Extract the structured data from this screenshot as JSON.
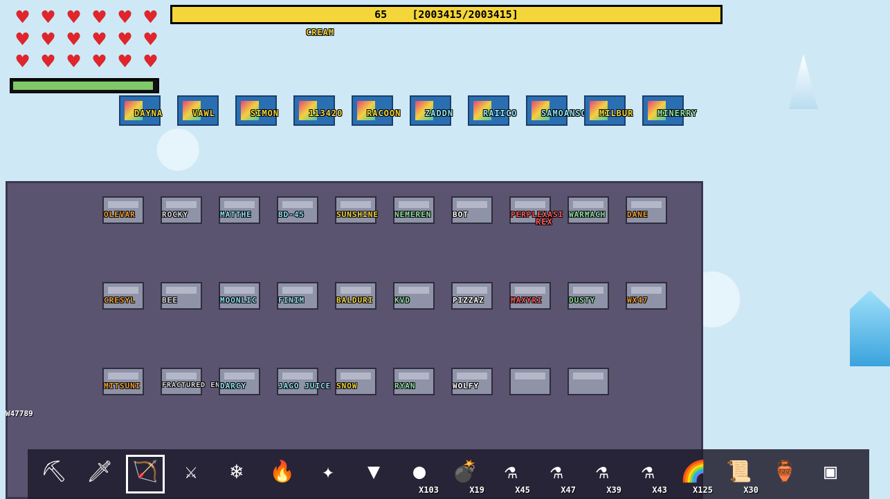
{
  "hud": {
    "hearts": 18,
    "heart_icon": "♥",
    "energy_fraction": 0.98,
    "level": "65",
    "xp_text": "[2003415/2003415]"
  },
  "top_row_names": [
    "CREAM"
  ],
  "pedestal_names": [
    "DAYNA",
    "VAWL",
    "SIMON",
    "113420",
    "RACOON",
    "ZADDN",
    "RAIICO",
    "SAMOANSO",
    "MILBUR",
    "MINERRY"
  ],
  "statue_rows": [
    [
      "OLEVAR",
      "ROCKY",
      "MATTHE",
      "BD-45",
      "SUNSHINE",
      "NEMEREN",
      "BOT",
      "PERPLEXASI",
      "WARMACH",
      "DANE"
    ],
    [
      "CRESYL",
      "BEE",
      "MOONLIC",
      "FINIM",
      "BALDURI",
      "KVD",
      "PIZZAZ",
      "MAXYRI",
      "DUSTY",
      "WX47"
    ],
    [
      "MITSUNI",
      "FRACTURED ENCODING",
      "DARCY",
      "JAGO JUICE",
      "SNOW",
      "RYAN",
      "WOLFY",
      "",
      ""
    ]
  ],
  "statue_row1_sublabel": "REX",
  "left_player_label": "W47789",
  "hotbar": [
    {
      "icon": "pickaxe-icon",
      "glyph": "⛏",
      "count": ""
    },
    {
      "icon": "sword-icon",
      "glyph": "🗡",
      "count": ""
    },
    {
      "icon": "bow-icon",
      "glyph": "🏹",
      "count": "",
      "selected": true
    },
    {
      "icon": "spear-icon",
      "glyph": "⚔",
      "count": ""
    },
    {
      "icon": "ice-rod-icon",
      "glyph": "❄",
      "count": ""
    },
    {
      "icon": "fire-rod-icon",
      "glyph": "🔥",
      "count": ""
    },
    {
      "icon": "bone-rod-icon",
      "glyph": "✦",
      "count": ""
    },
    {
      "icon": "drill-icon",
      "glyph": "▼",
      "count": ""
    },
    {
      "icon": "orb-icon",
      "glyph": "●",
      "count": "X103"
    },
    {
      "icon": "bomb-icon",
      "glyph": "💣",
      "count": "X19"
    },
    {
      "icon": "potion-blue-icon",
      "glyph": "⚗",
      "count": "X45"
    },
    {
      "icon": "potion-red-icon",
      "glyph": "⚗",
      "count": "X47"
    },
    {
      "icon": "potion-yellow-icon",
      "glyph": "⚗",
      "count": "X39"
    },
    {
      "icon": "potion-multi-icon",
      "glyph": "⚗",
      "count": "X43"
    },
    {
      "icon": "rainbow-jar-icon",
      "glyph": "🌈",
      "count": "X125"
    },
    {
      "icon": "scroll-icon",
      "glyph": "📜",
      "count": "X30"
    },
    {
      "icon": "jar-icon",
      "glyph": "🏺",
      "count": ""
    },
    {
      "icon": "green-screen-icon",
      "glyph": "▣",
      "count": ""
    }
  ],
  "colors": {
    "heart": "#e2252b",
    "xp": "#f5d63a",
    "floor": "#5b5470"
  }
}
